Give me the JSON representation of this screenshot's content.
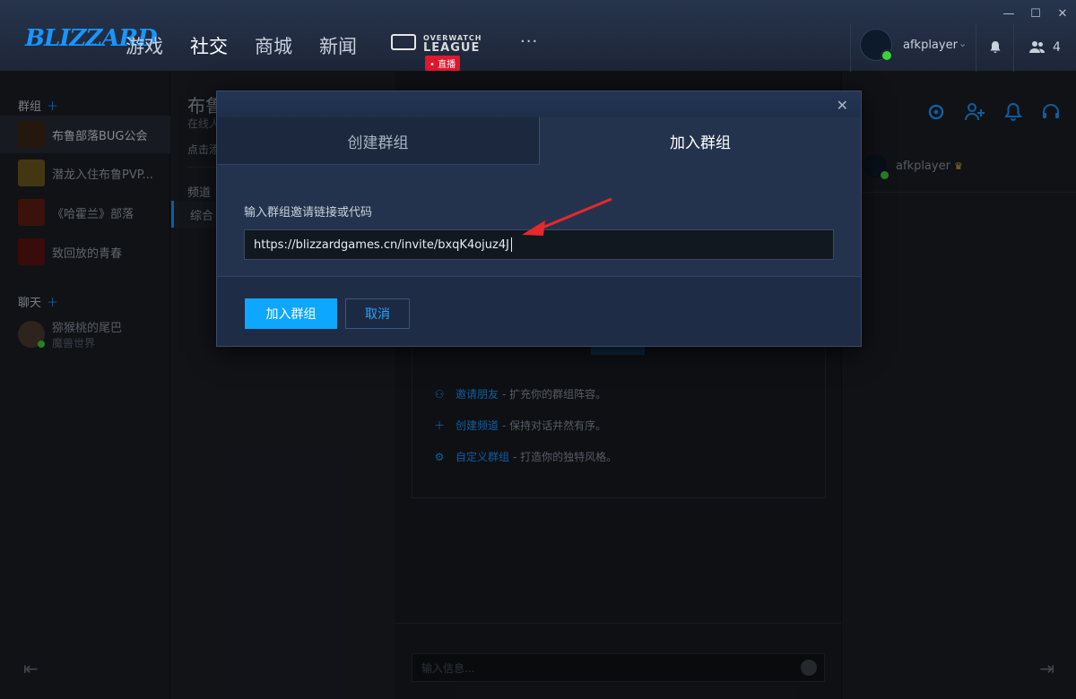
{
  "window": {
    "controls": [
      "—",
      "☐",
      "✕"
    ]
  },
  "header": {
    "logo": "BLIZZARD",
    "nav": [
      "游戏",
      "社交",
      "商城",
      "新闻"
    ],
    "active_nav": "社交",
    "owl_line1": "OVERWATCH",
    "owl_line2": "LEAGUE",
    "live_badge": "• 直播",
    "more": "···",
    "account_name": "afkplayer",
    "friends_count": "4"
  },
  "sidebar": {
    "groups_title": "群组",
    "groups": [
      {
        "name": "布鲁部落BUG公会",
        "color": "#3a2616"
      },
      {
        "name": "潜龙入住布鲁PVP...",
        "color": "#6b5a1d"
      },
      {
        "name": "《哈霍兰》部落",
        "color": "#5e1d12"
      },
      {
        "name": "致回放的青春",
        "color": "#5a1412"
      }
    ],
    "chat_title": "聊天",
    "dm": {
      "name": "猕猴桃的尾巴",
      "sub": "魔兽世界"
    }
  },
  "channels": {
    "title": "布鲁",
    "subtitle": "在线人",
    "hint": "点击添",
    "section": "频道",
    "selected": "综合"
  },
  "main": {
    "tips": [
      {
        "link": "邀请朋友",
        "text": "- 扩充你的群组阵容。"
      },
      {
        "link": "创建频道",
        "text": "- 保持对话井然有序。"
      },
      {
        "link": "自定义群组",
        "text": "- 打造你的独特风格。"
      }
    ],
    "input_placeholder": "输入信息..."
  },
  "members": {
    "name": "afkplayer"
  },
  "modal": {
    "tab_create": "创建群组",
    "tab_join": "加入群组",
    "field_label": "输入群组邀请链接或代码",
    "invite_value": "https://blizzardgames.cn/invite/bxqK4ojuz4J",
    "join_button": "加入群组",
    "cancel_button": "取消"
  },
  "colors": {
    "accent": "#0da7ff",
    "online": "#3ed13e",
    "live": "#e0182d",
    "annotation": "#e8282a"
  }
}
